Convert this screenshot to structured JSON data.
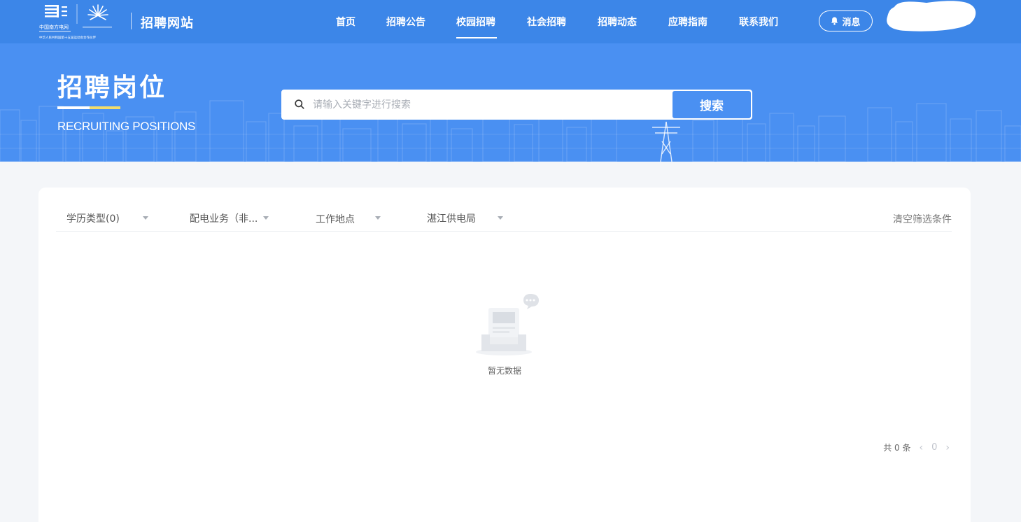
{
  "header": {
    "logo_text_main": "中国南方电网",
    "logo_text_sub": "中华人民共和国第十五届运动会合作伙伴",
    "site_title": "招聘网站",
    "nav": [
      {
        "label": "首页"
      },
      {
        "label": "招聘公告"
      },
      {
        "label": "校园招聘",
        "active": true
      },
      {
        "label": "社会招聘"
      },
      {
        "label": "招聘动态"
      },
      {
        "label": "应聘指南"
      },
      {
        "label": "联系我们"
      }
    ],
    "message_label": "消息"
  },
  "banner": {
    "title": "招聘岗位",
    "subtitle": "RECRUITING POSITIONS",
    "search": {
      "placeholder": "请输入关键字进行搜索",
      "value": "",
      "button_label": "搜索"
    }
  },
  "filters": {
    "items": [
      {
        "label": "学历类型(0)"
      },
      {
        "label": "配电业务（非..."
      },
      {
        "label": "工作地点"
      },
      {
        "label": "湛江供电局"
      }
    ],
    "clear_label": "清空筛选条件"
  },
  "results": {
    "empty_text": "暂无数据"
  },
  "pagination": {
    "total_text": "共 0 条",
    "current_page": "0",
    "prev_icon": "chevron-left-icon",
    "next_icon": "chevron-right-icon"
  },
  "colors": {
    "nav_bg": "#3c86e8",
    "banner_bg": "#4a90f2",
    "accent_yellow": "#f1dc6b",
    "page_bg": "#f4f6f9"
  }
}
